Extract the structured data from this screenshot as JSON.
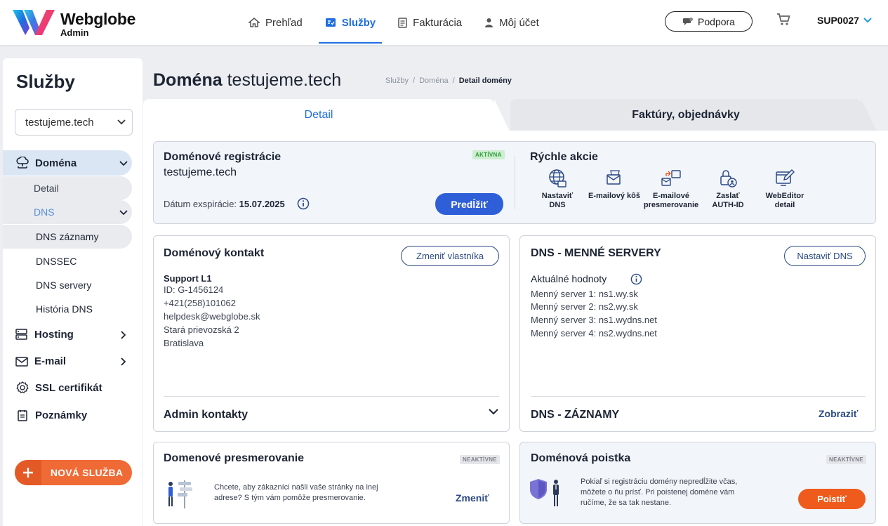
{
  "header": {
    "brand_name": "Webglobe",
    "brand_sub": "Admin",
    "nav": [
      {
        "label": "Prehľad",
        "icon": "home-icon"
      },
      {
        "label": "Služby",
        "icon": "services-icon"
      },
      {
        "label": "Fakturácia",
        "icon": "invoice-icon"
      },
      {
        "label": "Môj účet",
        "icon": "user-icon"
      }
    ],
    "support_label": "Podpora",
    "account_label": "SUP0027"
  },
  "sidebar": {
    "title": "Služby",
    "select_value": "testujeme.tech",
    "items": {
      "domena": "Doména",
      "detail": "Detail",
      "dns": "DNS",
      "dns_zaznamy": "DNS záznamy",
      "dnssec": "DNSSEC",
      "dns_servery": "DNS servery",
      "historia_dns": "História DNS",
      "hosting": "Hosting",
      "email": "E-mail",
      "ssl": "SSL certifikát",
      "poznamky": "Poznámky"
    },
    "new_service_label": "NOVÁ SLUŽBA"
  },
  "page": {
    "title_bold": "Doména",
    "title_rest": "testujeme.tech",
    "breadcrumb": [
      "Služby",
      "Doména",
      "Detail domény"
    ]
  },
  "tabs": {
    "detail": "Detail",
    "faktury": "Faktúry, objednávky"
  },
  "registration": {
    "title": "Doménové registrácie",
    "badge": "AKTÍVNA",
    "domain": "testujeme.tech",
    "expiry_label": "Dátum exspirácie:",
    "expiry_value": "15.07.2025",
    "extend_label": "Predĺžiť"
  },
  "quick_actions": {
    "title": "Rýchle akcie",
    "items": [
      {
        "label_1": "Nastaviť",
        "label_2": "DNS"
      },
      {
        "label_1": "E-mailový kôš",
        "label_2": ""
      },
      {
        "label_1": "E-mailové",
        "label_2": "presmerovanie"
      },
      {
        "label_1": "Zaslať",
        "label_2": "AUTH-ID"
      },
      {
        "label_1": "WebEditor",
        "label_2": "detail"
      }
    ]
  },
  "contact": {
    "title": "Doménový kontakt",
    "change_owner_label": "Zmeniť vlastníka",
    "name": "Support L1",
    "id": "ID: G-1456124",
    "phone": "+421(258)101062",
    "email": "helpdesk@webglobe.sk",
    "street": "Stará prievozská 2",
    "city": "Bratislava",
    "admin_contacts_label": "Admin kontakty"
  },
  "dns_servers": {
    "title": "DNS - MENNÉ SERVERY",
    "set_dns_label": "Nastaviť DNS",
    "current_label": "Aktuálné hodnoty",
    "servers": [
      "Menný server 1: ns1.wy.sk",
      "Menný server 2: ns2.wy.sk",
      "Menný server 3: ns1.wydns.net",
      "Menný server 4: ns2.wydns.net"
    ],
    "records_title": "DNS - ZÁZNAMY",
    "show_label": "Zobraziť"
  },
  "redirect": {
    "title": "Domenové presmerovanie",
    "badge": "NEAKTÍVNE",
    "text_1": "Chcete, aby zákazníci našli vaše stránky na inej",
    "text_2": "adrese? S tým vám pomôže presmerovanie.",
    "change_label": "Zmeniť"
  },
  "insurance": {
    "title": "Doménová poistka",
    "badge": "NEAKTÍVNE",
    "text_1": "Pokiaľ si registráciu domény nepredĺžite včas,",
    "text_2": "môžete o ňu prísť. Pri poistenej doméne vám",
    "text_3": "ručíme, že sa tak nestane.",
    "insure_label": "Poistiť"
  },
  "colors": {
    "accent": "#1f6ee0",
    "primary_button": "#2f5fd8",
    "orange": "#ef5b1c",
    "active_green": "#2f9a3b"
  }
}
